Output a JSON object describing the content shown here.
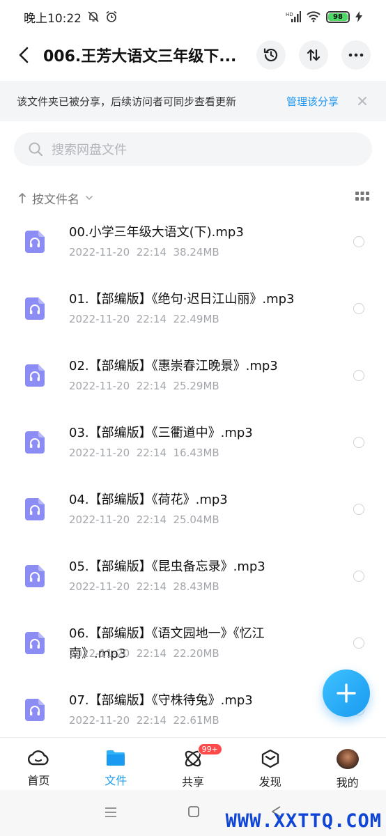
{
  "status_bar": {
    "time": "晚上10:22",
    "battery": "98"
  },
  "header": {
    "title": "006.王芳大语文三年级下..."
  },
  "share_banner": {
    "text": "该文件夹已被分享，后续访问者可同步查看更新",
    "manage": "管理该分享"
  },
  "search": {
    "placeholder": "搜索网盘文件"
  },
  "sort": {
    "label": "按文件名"
  },
  "files": [
    {
      "name": "00.小学三年级大语文(下).mp3",
      "date": "2022-11-20",
      "time": "22:14",
      "size": "38.24MB"
    },
    {
      "name": "01.【部编版】《绝句·迟日江山丽》.mp3",
      "date": "2022-11-20",
      "time": "22:14",
      "size": "22.49MB"
    },
    {
      "name": "02.【部编版】《惠崇春江晚景》.mp3",
      "date": "2022-11-20",
      "time": "22:14",
      "size": "25.29MB"
    },
    {
      "name": "03.【部编版】《三衢道中》.mp3",
      "date": "2022-11-20",
      "time": "22:14",
      "size": "16.43MB"
    },
    {
      "name": "04.【部编版】《荷花》.mp3",
      "date": "2022-11-20",
      "time": "22:14",
      "size": "25.04MB"
    },
    {
      "name": "05.【部编版】《昆虫备忘录》.mp3",
      "date": "2022-11-20",
      "time": "22:14",
      "size": "28.43MB"
    },
    {
      "name": "06.【部编版】《语文园地一》《忆江南》.mp3",
      "date": "2022-11-20",
      "time": "22:14",
      "size": "22.20MB"
    },
    {
      "name": "07.【部编版】《守株待兔》.mp3",
      "date": "2022-11-20",
      "time": "22:14",
      "size": "22.61MB"
    }
  ],
  "bottom_nav": {
    "home": "首页",
    "files": "文件",
    "share": "共享",
    "share_badge": "99+",
    "discover": "发现",
    "mine": "我的"
  },
  "watermark": "WWW.XXTTQ.COM",
  "colors": {
    "accent": "#1a9af0",
    "file_icon": "#8c8cf5",
    "badge": "#ff4a4a"
  }
}
